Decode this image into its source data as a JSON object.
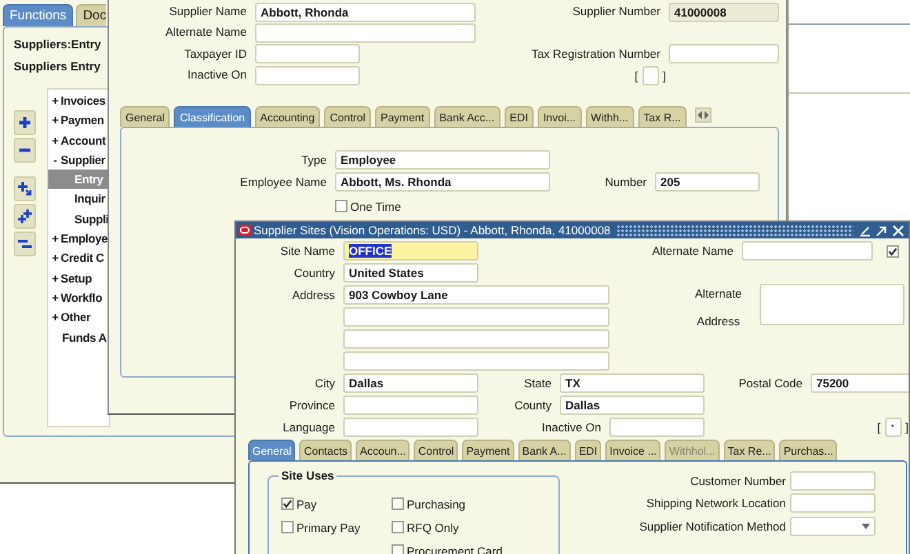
{
  "navigator": {
    "tabs": [
      {
        "label": "Functions",
        "selected": true
      },
      {
        "label": "Doc",
        "selected": false
      }
    ],
    "context": [
      "Suppliers:Entry",
      "Suppliers Entry"
    ],
    "tree": [
      {
        "expander": "+",
        "label": "Invoices",
        "selected": false
      },
      {
        "expander": "+",
        "label": "Paymen",
        "selected": false
      },
      {
        "expander": "+",
        "label": "Account",
        "selected": false
      },
      {
        "expander": "-",
        "label": "Supplier",
        "selected": false,
        "children": [
          {
            "label": "Entry",
            "selected": true
          },
          {
            "label": "Inquir",
            "selected": false
          },
          {
            "label": "Suppli",
            "selected": false
          }
        ]
      },
      {
        "expander": "+",
        "label": "Employe",
        "selected": false
      },
      {
        "expander": "+",
        "label": "Credit C",
        "selected": false
      },
      {
        "expander": "+",
        "label": "Setup",
        "selected": false
      },
      {
        "expander": "+",
        "label": "Workflo",
        "selected": false
      },
      {
        "expander": "+",
        "label": "Other",
        "selected": false
      },
      {
        "label": "Funds A",
        "selected": false
      }
    ]
  },
  "supplier": {
    "fields": [
      {
        "label": "Supplier Name",
        "value": "Abbott, Rhonda",
        "kind": "text"
      },
      {
        "label": "Supplier Number",
        "value": "41000008",
        "kind": "readonly"
      },
      {
        "label": "Alternate Name",
        "kind": "text"
      },
      {
        "label": "Taxpayer ID",
        "kind": "text"
      },
      {
        "label": "Tax Registration Number",
        "kind": "text"
      },
      {
        "label": "Inactive On",
        "kind": "text"
      }
    ],
    "flexfield": {
      "open": "[",
      "close": "]"
    },
    "tabs": [
      {
        "label": "General",
        "selected": false
      },
      {
        "label": "Classification",
        "selected": true
      },
      {
        "label": "Accounting",
        "selected": false
      },
      {
        "label": "Control",
        "selected": false
      },
      {
        "label": "Payment",
        "selected": false
      },
      {
        "label": "Bank Acc...",
        "selected": false
      },
      {
        "label": "EDI",
        "selected": false
      },
      {
        "label": "Invoi...",
        "selected": false
      },
      {
        "label": "Withh...",
        "selected": false
      },
      {
        "label": "Tax R...",
        "selected": false
      }
    ],
    "classification": {
      "fields": [
        {
          "label": "Type",
          "value": "Employee",
          "kind": "text"
        },
        {
          "label": "Employee Name",
          "value": "Abbott, Ms. Rhonda",
          "kind": "text"
        },
        {
          "label": "Number",
          "value": "205",
          "kind": "text"
        }
      ],
      "checkboxes": [
        {
          "label": "One Time",
          "checked": false
        }
      ]
    }
  },
  "sites": {
    "title": "Supplier Sites (Vision Operations: USD) - Abbott, Rhonda, 41000008",
    "fields": [
      {
        "label": "Site Name",
        "value": "OFFICE",
        "kind": "focused"
      },
      {
        "label": "Alternate Name",
        "kind": "text"
      },
      {
        "label": "Country",
        "value": "United States",
        "kind": "text"
      },
      {
        "label": "Address",
        "value": "903 Cowboy Lane",
        "kind": "text"
      },
      {
        "kind": "text"
      },
      {
        "kind": "text"
      },
      {
        "kind": "text"
      },
      {
        "label": "Alternate Address",
        "kind": "textarea"
      },
      {
        "label": "City",
        "value": "Dallas",
        "kind": "text"
      },
      {
        "label": "State",
        "value": "TX",
        "kind": "text"
      },
      {
        "label": "Postal Code",
        "value": "75200",
        "kind": "text"
      },
      {
        "label": "Province",
        "kind": "text"
      },
      {
        "label": "County",
        "value": "Dallas",
        "kind": "text"
      },
      {
        "label": "Language",
        "kind": "text"
      },
      {
        "label": "Inactive On",
        "kind": "text"
      }
    ],
    "flag": {
      "checked": true
    },
    "flexfield": {
      "open": "[",
      "value": "·",
      "close": "]"
    },
    "tabs": [
      {
        "label": "General",
        "selected": true,
        "disabled": false
      },
      {
        "label": "Contacts",
        "selected": false,
        "disabled": false
      },
      {
        "label": "Accoun...",
        "selected": false,
        "disabled": false
      },
      {
        "label": "Control",
        "selected": false,
        "disabled": false
      },
      {
        "label": "Payment",
        "selected": false,
        "disabled": false
      },
      {
        "label": "Bank A...",
        "selected": false,
        "disabled": false
      },
      {
        "label": "EDI",
        "selected": false,
        "disabled": false
      },
      {
        "label": "Invoice ...",
        "selected": false,
        "disabled": false
      },
      {
        "label": "Withhol...",
        "selected": false,
        "disabled": true
      },
      {
        "label": "Tax Re...",
        "selected": false,
        "disabled": false
      },
      {
        "label": "Purchas...",
        "selected": false,
        "disabled": false
      }
    ],
    "site_uses": {
      "title": "Site Uses",
      "options": [
        {
          "label": "Pay",
          "checked": true
        },
        {
          "label": "Purchasing",
          "checked": false
        },
        {
          "label": "Primary Pay",
          "checked": false
        },
        {
          "label": "RFQ Only",
          "checked": false
        },
        {
          "label": "Procurement Card",
          "checked": false
        }
      ]
    },
    "other_fields": [
      {
        "label": "Customer Number",
        "kind": "text"
      },
      {
        "label": "Shipping Network Location",
        "kind": "text"
      },
      {
        "label": "Supplier Notification Method",
        "kind": "dropdown"
      }
    ]
  }
}
